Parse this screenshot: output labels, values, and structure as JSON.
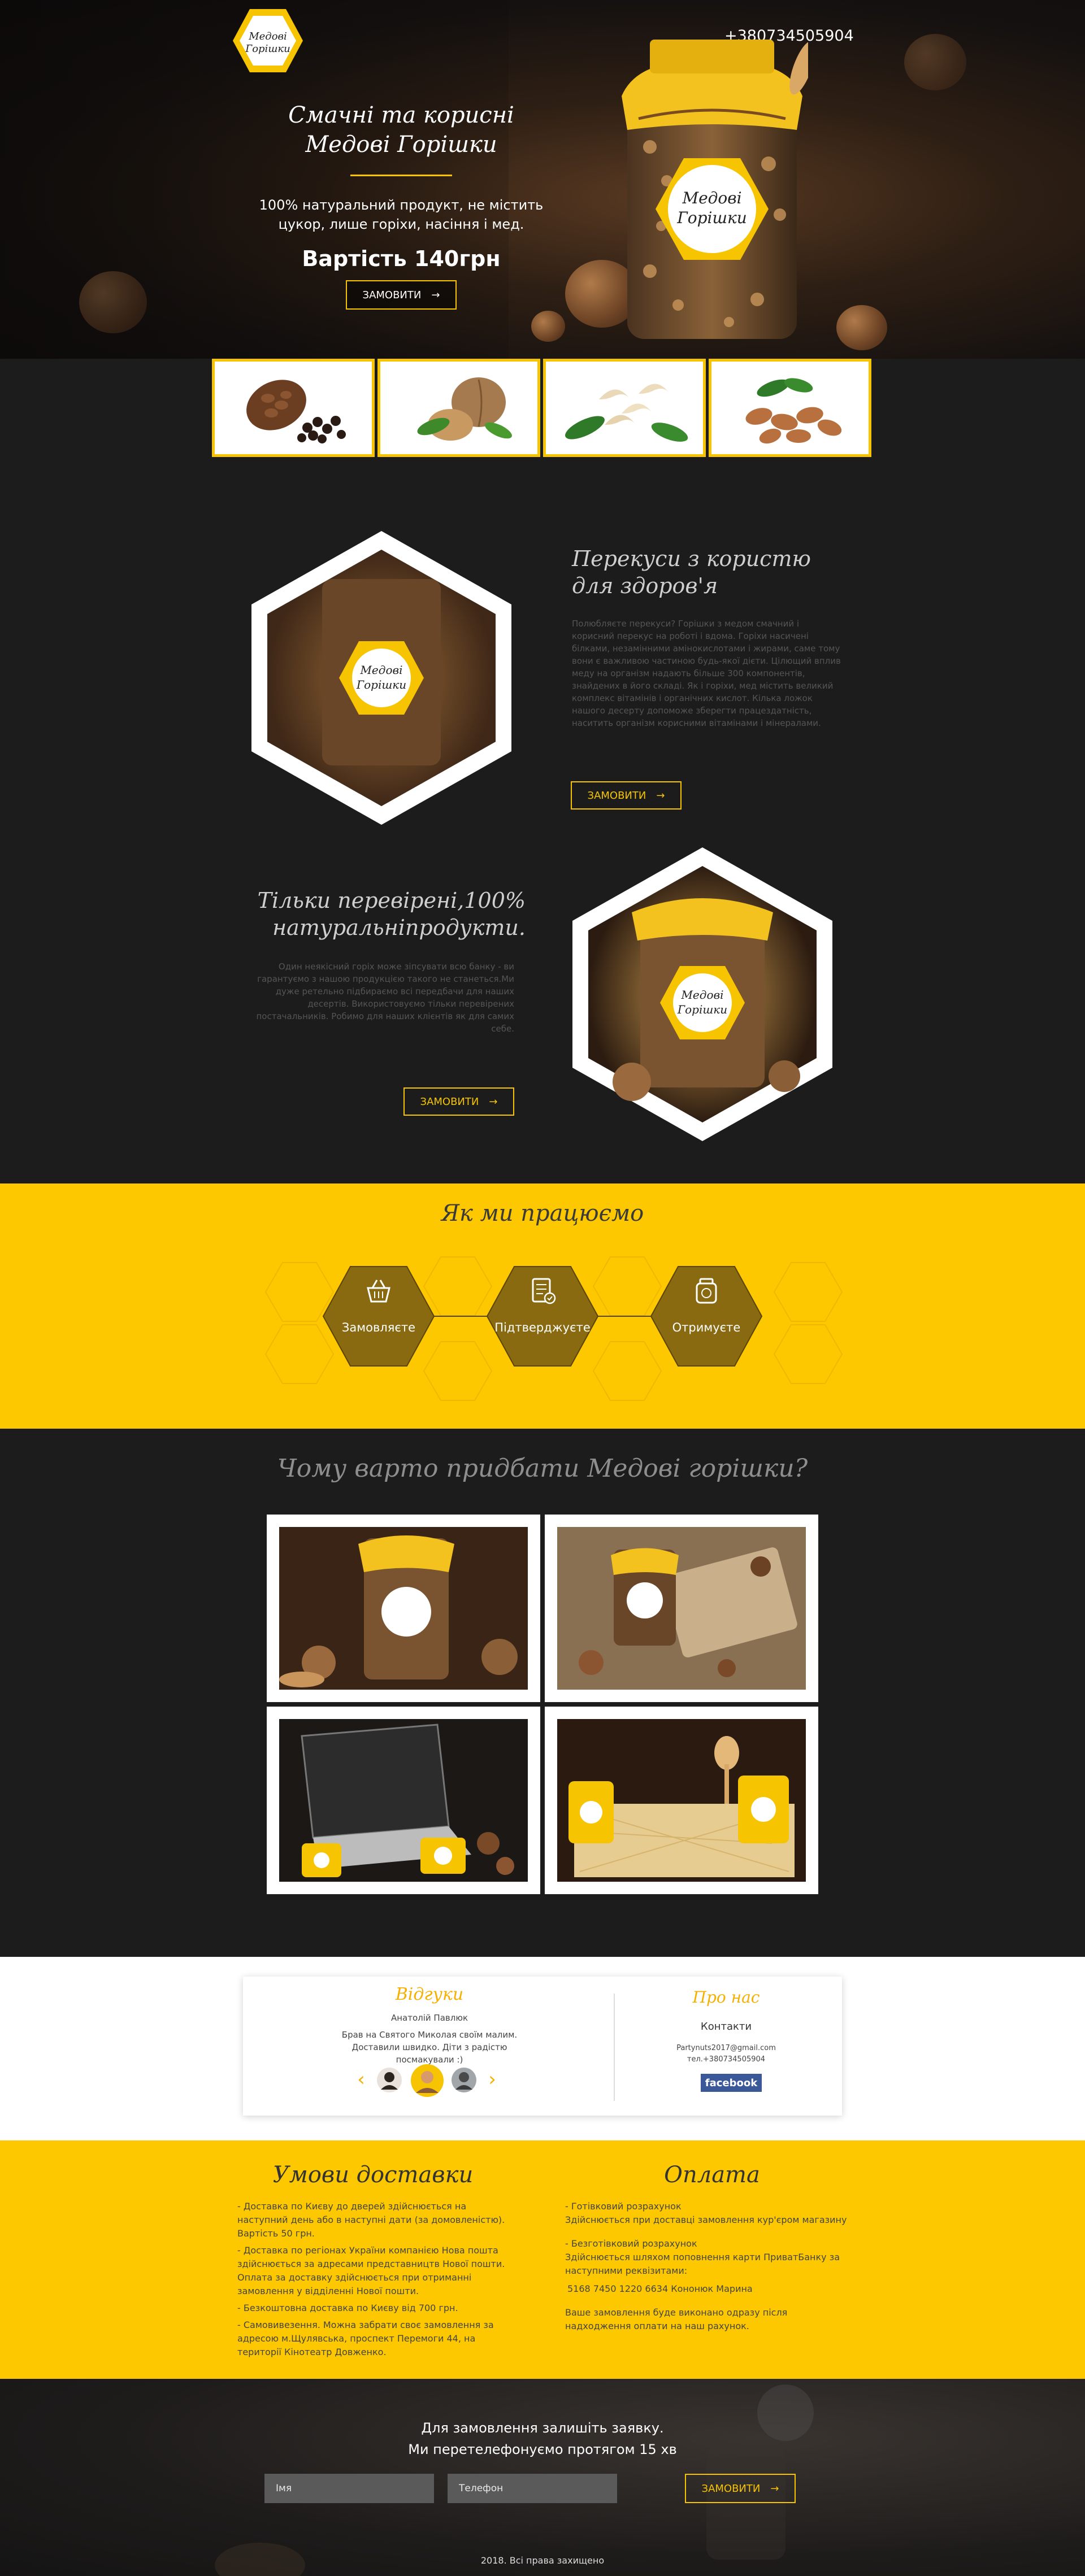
{
  "colors": {
    "accent": "#f6c400",
    "yellow_bg": "#fdc800",
    "dark_bg": "#1c1c1c",
    "step_brown": "#8a6a10"
  },
  "hero": {
    "logo_text_1": "Медові",
    "logo_text_2": "Горішки",
    "phone": "+380734505904",
    "title_line1": "Смачні та корисні",
    "title_line2": "Медові Горішки",
    "description": "100% натуральний продукт, не містить цукор, лише горіхи, насіння і мед.",
    "price": "Вартість 140грн",
    "order_button": "ЗАМОВИТИ",
    "jar_label_1": "Медові",
    "jar_label_2": "Горішки"
  },
  "nut_cards": [
    {
      "name": "pine-nuts"
    },
    {
      "name": "walnuts"
    },
    {
      "name": "cashews"
    },
    {
      "name": "almonds"
    }
  ],
  "feature1": {
    "title_line1": "Перекуси з користю",
    "title_line2": "для здоров'я",
    "text": "Полюбляєте перекуси? Горішки з медом смачний і корисний перекус на роботі і вдома. Горіхи насичені білками, незамінними амінокислотами і жирами, саме тому вони є важливою частиною будь-якої дієти. Цілющий вплив меду на організм надають більше 300 компонентів, знайдених в його складі. Як і горіхи, мед містить великий комплекс вітамінів і органічних кислот. Кілька ложок нашого десерту допоможе зберегти працездатність, наситить організм корисними вітамінами і мінералами.",
    "button": "ЗАМОВИТИ"
  },
  "feature2": {
    "title_line1": "Тільки перевірені,100%",
    "title_line2": "натуральніпродукти.",
    "text": "Один неякісний горіх може зіпсувати всю банку - ви гарантуємо з нашою продукцією такого не станеться.Ми дуже ретельно підбираємо всі передбачи для наших десертів. Використовуємо тільки перевірених постачальників. Робимо для наших клієнтів як для самих себе.",
    "button": "ЗАМОВИТИ"
  },
  "how": {
    "title": "Як ми працюємо",
    "steps": [
      {
        "label": "Замовляєте",
        "icon": "basket-icon"
      },
      {
        "label": "Підтверджуєте",
        "icon": "checklist-icon"
      },
      {
        "label": "Отримуєте",
        "icon": "jar-icon"
      }
    ]
  },
  "why": {
    "title": "Чому варто придбати Медові горішки?"
  },
  "reviews": {
    "title": "Відгуки",
    "author": "Анатолій Павлюк",
    "text": "Брав на Святого Миколая своїм малим. Доставили швидко. Діти з радістю посмакували :)",
    "prev": "‹",
    "next": "›"
  },
  "about": {
    "title": "Про нас",
    "contacts_label": "Контакти",
    "email": "Partynuts2017@gmail.com",
    "phone": "тел.+380734505904",
    "facebook": "facebook"
  },
  "delivery": {
    "title": "Умови доставки",
    "items": [
      "- Доставка по Києву до дверей здійснюється на наступний день або в наступні дати (за домовленістю). Вартість 50 грн.",
      "- Доставка по регіонах України компанією Нова пошта здійснюється за адресами представництв Нової пошти. Оплата за доставку здійснюється при отриманні замовлення у відділенні Нової пошти.",
      "- Безкоштовна доставка по Києву від 700 грн.",
      "- Самовивезення. Можна забрати своє замовлення за адресою м.Щулявська,  проспект Перемоги 44, на території Кінотеатр Довженко."
    ]
  },
  "payment": {
    "title": "Оплата",
    "cash_title": "- Готівковий розрахунок",
    "cash_text": "Здійснюється при доставці замовлення кур'єром магазину",
    "card_title": "- Безготівковий розрахунок",
    "card_text": "Здійснюється шляхом поповнення карти ПриватБанку за наступними реквізитами:",
    "card_number": "5168 7450 1220 6634 Кононюк Марина",
    "note": "Ваше замовлення буде виконано одразу після надходження оплати на наш рахунок."
  },
  "footer": {
    "cta_line1": "Для замовлення залишіть заявку.",
    "cta_line2": "Ми перетелефонуємо протягом 15 хв",
    "name_placeholder": "Імя",
    "phone_placeholder": "Телефон",
    "submit": "ЗАМОВИТИ",
    "copyright": "2018. Всі права захищено"
  }
}
